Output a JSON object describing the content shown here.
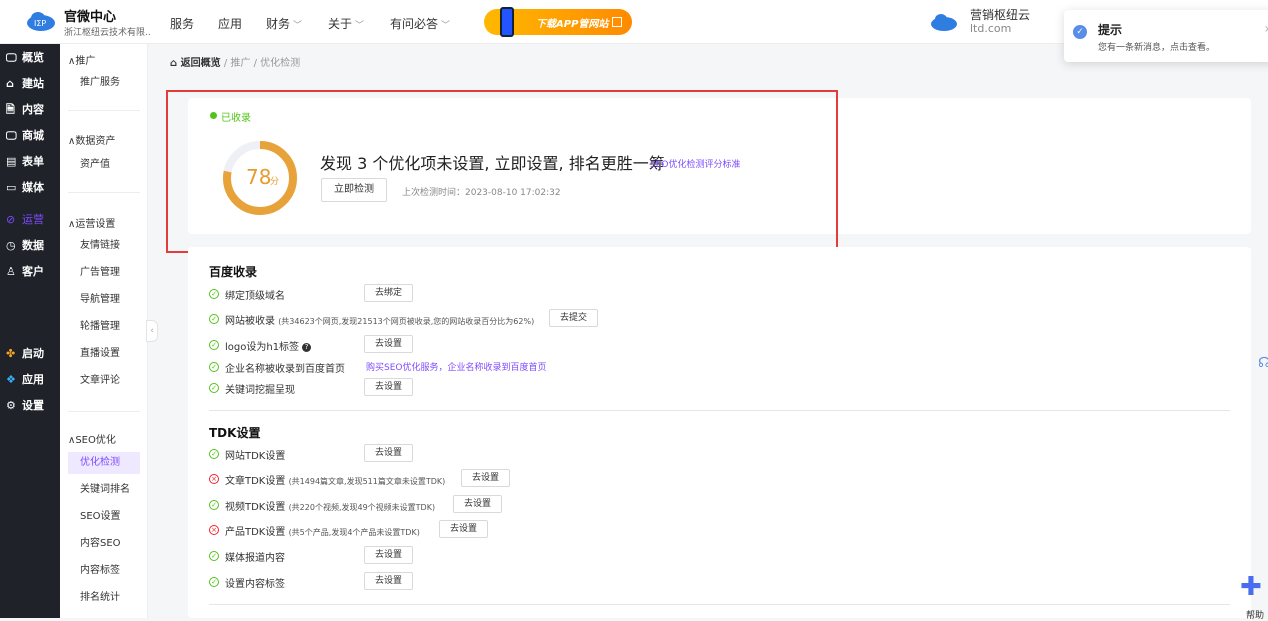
{
  "topbar": {
    "brand_title": "官微中心",
    "brand_subtitle": "浙江枢纽云技术有限...",
    "nav": [
      {
        "label": "服务",
        "has_menu": false
      },
      {
        "label": "应用",
        "has_menu": false
      },
      {
        "label": "财务",
        "has_menu": true
      },
      {
        "label": "关于",
        "has_menu": true
      },
      {
        "label": "有问必答",
        "has_menu": true
      }
    ],
    "app_banner": "下载APP管网站",
    "user_name": "营销枢纽云",
    "user_domain": "ltd.com"
  },
  "notification": {
    "title": "提示",
    "message": "您有一条新消息，点击查看。"
  },
  "leftnav": [
    {
      "icon": "overview-icon",
      "glyph": "🖵",
      "label": "概览"
    },
    {
      "icon": "site-icon",
      "glyph": "⌂",
      "label": "建站"
    },
    {
      "icon": "content-icon",
      "glyph": "🗎",
      "label": "内容"
    },
    {
      "icon": "shop-icon",
      "glyph": "🖵",
      "label": "商城"
    },
    {
      "icon": "form-icon",
      "glyph": "▤",
      "label": "表单"
    },
    {
      "icon": "media-icon",
      "glyph": "▭",
      "label": "媒体"
    },
    {
      "icon": "operation-icon",
      "glyph": "⊘",
      "label": "运营",
      "active": true
    },
    {
      "icon": "data-icon",
      "glyph": "◷",
      "label": "数据"
    },
    {
      "icon": "customer-icon",
      "glyph": "♙",
      "label": "客户"
    },
    {
      "icon": "launch-icon",
      "glyph": "✤",
      "label": "启动"
    },
    {
      "icon": "apps-icon",
      "glyph": "❖",
      "label": "应用"
    },
    {
      "icon": "settings-icon",
      "glyph": "⚙",
      "label": "设置"
    }
  ],
  "subnav": {
    "groups": [
      {
        "title": "推广",
        "items": [
          "推广服务"
        ]
      },
      {
        "title": "数据资产",
        "items": [
          "资产值"
        ]
      },
      {
        "title": "运营设置",
        "items": [
          "友情链接",
          "广告管理",
          "导航管理",
          "轮播管理",
          "直播设置",
          "文章评论"
        ]
      },
      {
        "title": "SEO优化",
        "items": [
          "优化检测",
          "关键词排名",
          "SEO设置",
          "内容SEO",
          "内容标签",
          "排名统计"
        ]
      }
    ],
    "active_item": "优化检测"
  },
  "breadcrumb": {
    "back": "返回概览",
    "sep": "/",
    "level1": "推广",
    "level2": "优化检测"
  },
  "score": {
    "status": "已收录",
    "value": 78,
    "value_text": "78",
    "unit": "分",
    "max": 100,
    "headline": "发现 3 个优化项未设置, 立即设置, 排名更胜一筹",
    "standard_link": "SEO优化检测评分标准",
    "check_button": "立即检测",
    "last_check": "上次检测时间：2023-08-10 17:02:32"
  },
  "baidu": {
    "title": "百度收录",
    "rows": [
      {
        "status": "ok",
        "text": "绑定顶级域名",
        "note": "",
        "button": "去绑定"
      },
      {
        "status": "ok",
        "text": "网站被收录",
        "note": "(共34623个网页,发现21513个网页被收录,您的网站收录百分比为62%)",
        "button": "去提交"
      },
      {
        "status": "ok",
        "text": "logo设为h1标签",
        "note": "",
        "button": "去设置"
      },
      {
        "status": "ok",
        "text": "企业名称被收录到百度首页",
        "note": "",
        "link": "购买SEO优化服务，企业名称收录到百度首页"
      },
      {
        "status": "ok",
        "text": "关键词挖掘呈现",
        "note": "",
        "button": "去设置"
      }
    ]
  },
  "tdk": {
    "title": "TDK设置",
    "rows": [
      {
        "status": "ok",
        "text": "网站TDK设置",
        "note": "",
        "button": "去设置"
      },
      {
        "status": "bad",
        "text": "文章TDK设置",
        "note": "(共1494篇文章,发现511篇文章未设置TDK)",
        "button": "去设置"
      },
      {
        "status": "ok",
        "text": "视频TDK设置",
        "note": "(共220个视频,发现49个视频未设置TDK)",
        "button": "去设置"
      },
      {
        "status": "bad",
        "text": "产品TDK设置",
        "note": "(共5个产品,发现4个产品未设置TDK)",
        "button": "去设置"
      },
      {
        "status": "ok",
        "text": "媒体报道内容",
        "note": "",
        "button": "去设置"
      },
      {
        "status": "ok",
        "text": "设置内容标签",
        "note": "",
        "button": "去设置"
      }
    ]
  },
  "help": {
    "label": "帮助"
  }
}
